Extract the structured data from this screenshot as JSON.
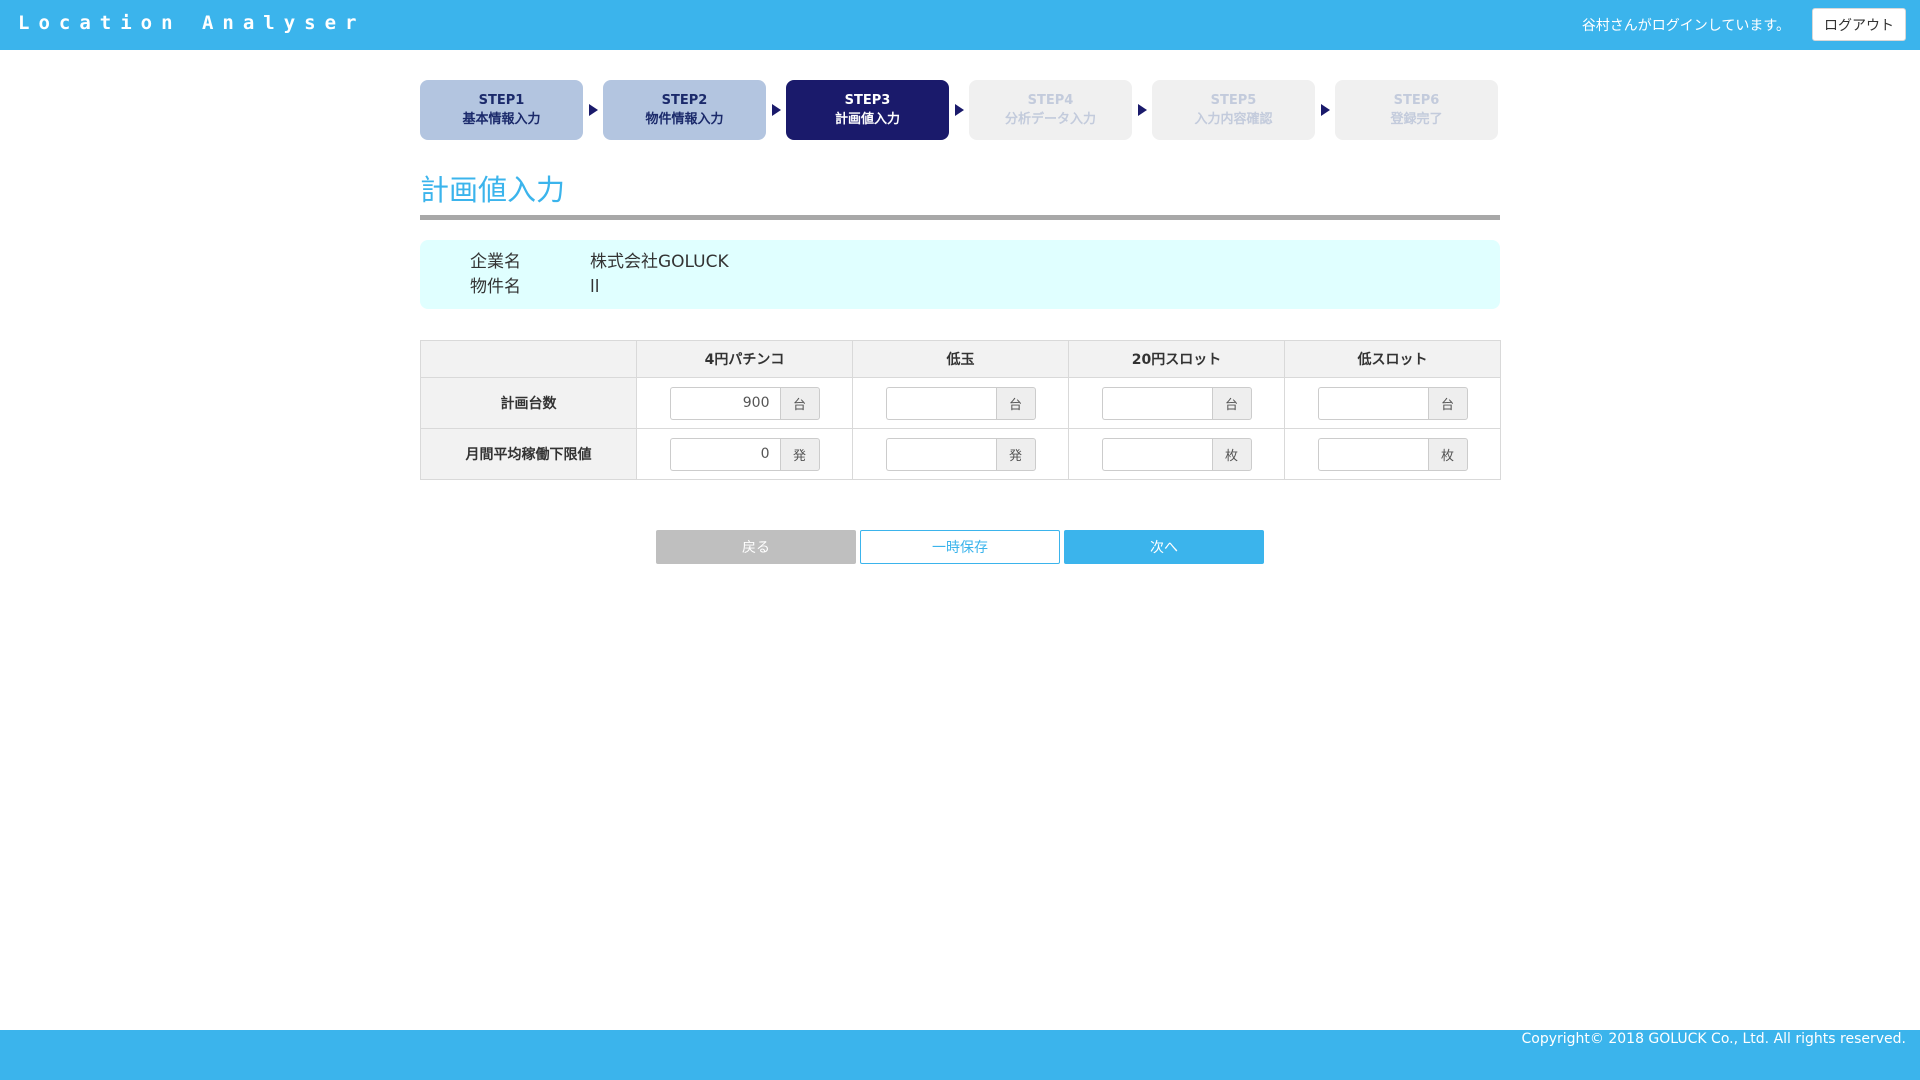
{
  "app": {
    "title": "Location Analyser",
    "login_message": "谷村さんがログインしています。",
    "logout_label": "ログアウト"
  },
  "steps": [
    {
      "label": "STEP1",
      "name": "基本情報入力",
      "state": "done"
    },
    {
      "label": "STEP2",
      "name": "物件情報入力",
      "state": "done"
    },
    {
      "label": "STEP3",
      "name": "計画値入力",
      "state": "current"
    },
    {
      "label": "STEP4",
      "name": "分析データ入力",
      "state": "todo"
    },
    {
      "label": "STEP5",
      "name": "入力内容確認",
      "state": "todo"
    },
    {
      "label": "STEP6",
      "name": "登録完了",
      "state": "todo"
    }
  ],
  "page": {
    "title": "計画値入力"
  },
  "info": {
    "company_label": "企業名",
    "company_value": "株式会社GOLUCK",
    "property_label": "物件名",
    "property_value": "ll"
  },
  "table": {
    "columns": [
      "4円パチンコ",
      "低玉",
      "20円スロット",
      "低スロット"
    ],
    "rows": [
      {
        "label": "計画台数",
        "cells": [
          {
            "value": "900",
            "unit": "台"
          },
          {
            "value": "",
            "unit": "台"
          },
          {
            "value": "",
            "unit": "台"
          },
          {
            "value": "",
            "unit": "台"
          }
        ]
      },
      {
        "label": "月間平均稼働下限値",
        "cells": [
          {
            "value": "0",
            "unit": "発"
          },
          {
            "value": "",
            "unit": "発"
          },
          {
            "value": "",
            "unit": "枚"
          },
          {
            "value": "",
            "unit": "枚"
          }
        ]
      }
    ]
  },
  "actions": {
    "back_label": "戻る",
    "save_label": "一時保存",
    "next_label": "次へ"
  },
  "footer": {
    "copyright": "Copyright© 2018 GOLUCK Co., Ltd. All rights reserved."
  },
  "colors": {
    "primary": "#3bb4ec",
    "step_current": "#1a1a6b",
    "step_done": "#b3c5e0",
    "step_todo": "#f0f0f0",
    "info_bg": "#e0ffff"
  }
}
